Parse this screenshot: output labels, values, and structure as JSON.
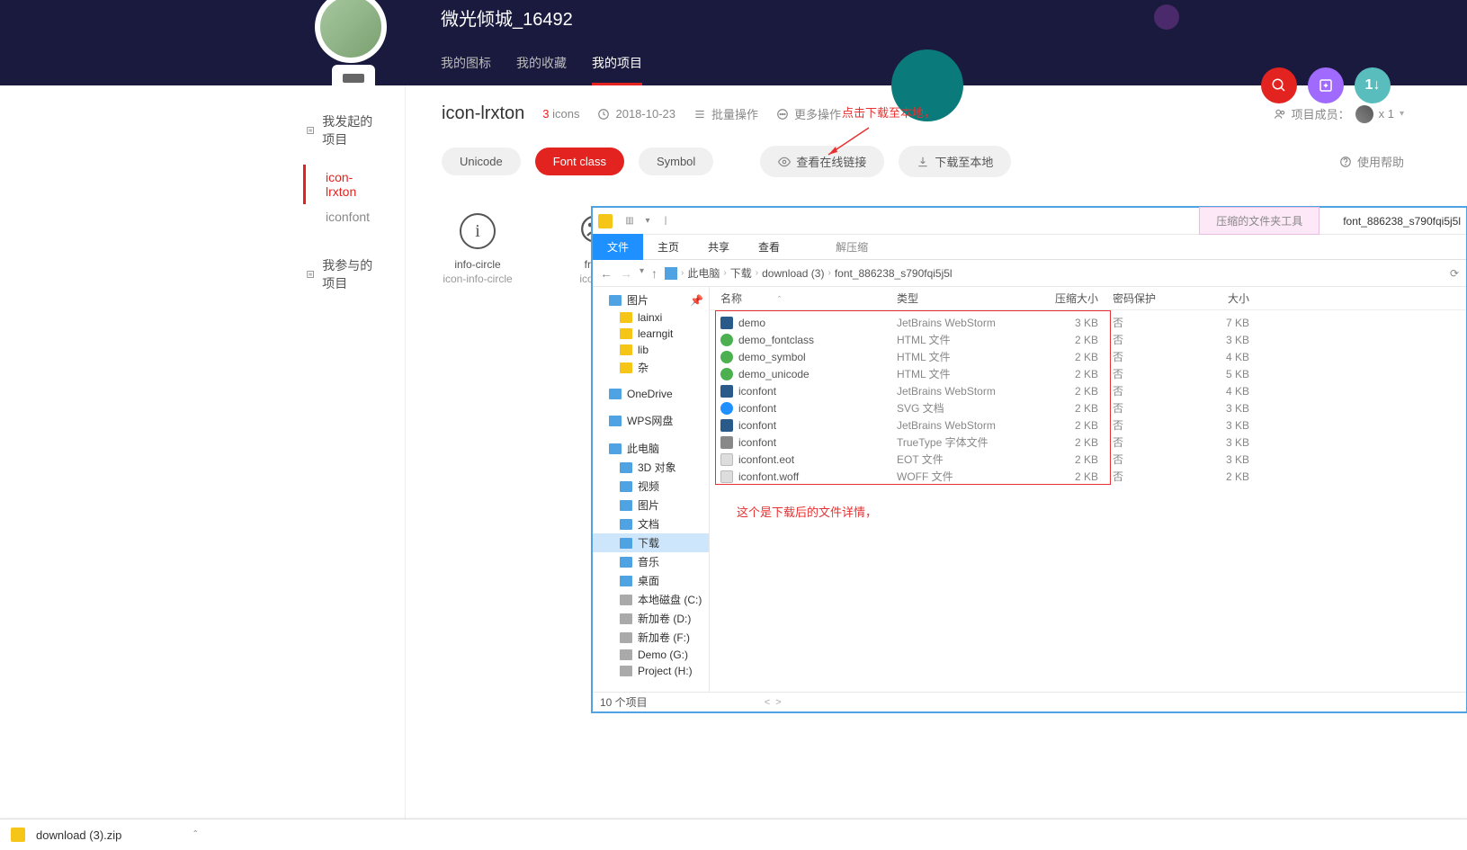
{
  "header": {
    "username": "微光倾城_16492",
    "tabs": [
      "我的图标",
      "我的收藏",
      "我的项目"
    ],
    "active_tab": 2
  },
  "float": {
    "avatar_label": "1↓"
  },
  "sidebar": {
    "section_started": "我发起的项目",
    "section_joined": "我参与的项目",
    "items": [
      "icon-lrxton",
      "iconfont"
    ],
    "active": 0
  },
  "project": {
    "name": "icon-lrxton",
    "count": "3",
    "count_unit": "icons",
    "date": "2018-10-23",
    "batch": "批量操作",
    "more": "更多操作",
    "members_label": "项目成员：",
    "members_count": "x 1"
  },
  "toolbar": {
    "unicode": "Unicode",
    "fontclass": "Font class",
    "symbol": "Symbol",
    "view_link": "查看在线链接",
    "download": "下载至本地",
    "help": "使用帮助"
  },
  "annot": {
    "download_hint": "点击下载至本地，",
    "files_hint": "这个是下载后的文件详情，"
  },
  "icons": [
    {
      "glyph": "i",
      "l1": "info-circle",
      "l2": "icon-info-circle"
    },
    {
      "glyph": "☹",
      "l1": "frow",
      "l2": "icon-fr"
    }
  ],
  "explorer": {
    "title_tab": "压缩的文件夹工具",
    "window_name": "font_886238_s790fqi5j5l",
    "ribbon": [
      "文件",
      "主页",
      "共享",
      "查看",
      "解压缩"
    ],
    "ribbon_active": 0,
    "crumbs": [
      "此电脑",
      "下载",
      "download (3)",
      "font_886238_s790fqi5j5l"
    ],
    "tree": {
      "pictures": "图片",
      "pin": "📌",
      "folders": [
        "lainxi",
        "learngit",
        "lib",
        "杂"
      ],
      "onedrive": "OneDrive",
      "wps": "WPS网盘",
      "thispc": "此电脑",
      "pc_items": [
        "3D 对象",
        "视频",
        "图片",
        "文档",
        "下载",
        "音乐",
        "桌面",
        "本地磁盘 (C:)",
        "新加卷 (D:)",
        "新加卷 (F:)",
        "Demo (G:)",
        "Project (H:)"
      ],
      "pc_sel": 4
    },
    "cols": {
      "name": "名称",
      "type": "类型",
      "csize": "压缩大小",
      "pwd": "密码保护",
      "size": "大小"
    },
    "files": [
      {
        "ic": "ws",
        "n": "demo",
        "t": "JetBrains WebStorm",
        "cs": "3 KB",
        "p": "否",
        "s": "7 KB"
      },
      {
        "ic": "ch",
        "n": "demo_fontclass",
        "t": "HTML 文件",
        "cs": "2 KB",
        "p": "否",
        "s": "3 KB"
      },
      {
        "ic": "ch",
        "n": "demo_symbol",
        "t": "HTML 文件",
        "cs": "2 KB",
        "p": "否",
        "s": "4 KB"
      },
      {
        "ic": "ch",
        "n": "demo_unicode",
        "t": "HTML 文件",
        "cs": "2 KB",
        "p": "否",
        "s": "5 KB"
      },
      {
        "ic": "ws",
        "n": "iconfont",
        "t": "JetBrains WebStorm",
        "cs": "2 KB",
        "p": "否",
        "s": "4 KB"
      },
      {
        "ic": "ie",
        "n": "iconfont",
        "t": "SVG 文档",
        "cs": "2 KB",
        "p": "否",
        "s": "3 KB"
      },
      {
        "ic": "ws",
        "n": "iconfont",
        "t": "JetBrains WebStorm",
        "cs": "2 KB",
        "p": "否",
        "s": "3 KB"
      },
      {
        "ic": "tt",
        "n": "iconfont",
        "t": "TrueType 字体文件",
        "cs": "2 KB",
        "p": "否",
        "s": "3 KB"
      },
      {
        "ic": "gen",
        "n": "iconfont.eot",
        "t": "EOT 文件",
        "cs": "2 KB",
        "p": "否",
        "s": "3 KB"
      },
      {
        "ic": "gen",
        "n": "iconfont.woff",
        "t": "WOFF 文件",
        "cs": "2 KB",
        "p": "否",
        "s": "2 KB"
      }
    ],
    "status": "10 个项目"
  },
  "download_bar": {
    "file": "download (3).zip"
  }
}
